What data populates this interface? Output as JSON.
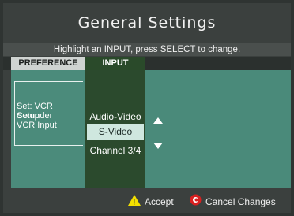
{
  "header": {
    "title": "General Settings",
    "help_text": "Highlight an INPUT, press SELECT to change."
  },
  "columns": {
    "preference": "PREFERENCE",
    "input": "INPUT"
  },
  "preference": {
    "lines": [
      "Set: VCR Comnder",
      "Setup",
      "VCR Input"
    ]
  },
  "input": {
    "options": [
      "Audio-Video",
      "S-Video",
      "Channel 3/4"
    ],
    "selected": "S-Video"
  },
  "footer": {
    "accept_label": "Accept",
    "cancel_label": "Cancel Changes"
  },
  "colors": {
    "background": "#3b403e",
    "panel": "#4a8a7a",
    "input_column": "#2b4a2d",
    "highlight": "#cfe7df",
    "accept_icon": "#f3e000",
    "cancel_icon": "#d92020"
  },
  "icons": {
    "up": "triangle-up-icon",
    "down": "triangle-down-icon",
    "accept": "yellow-triangle-icon",
    "cancel": "red-circle-icon"
  }
}
